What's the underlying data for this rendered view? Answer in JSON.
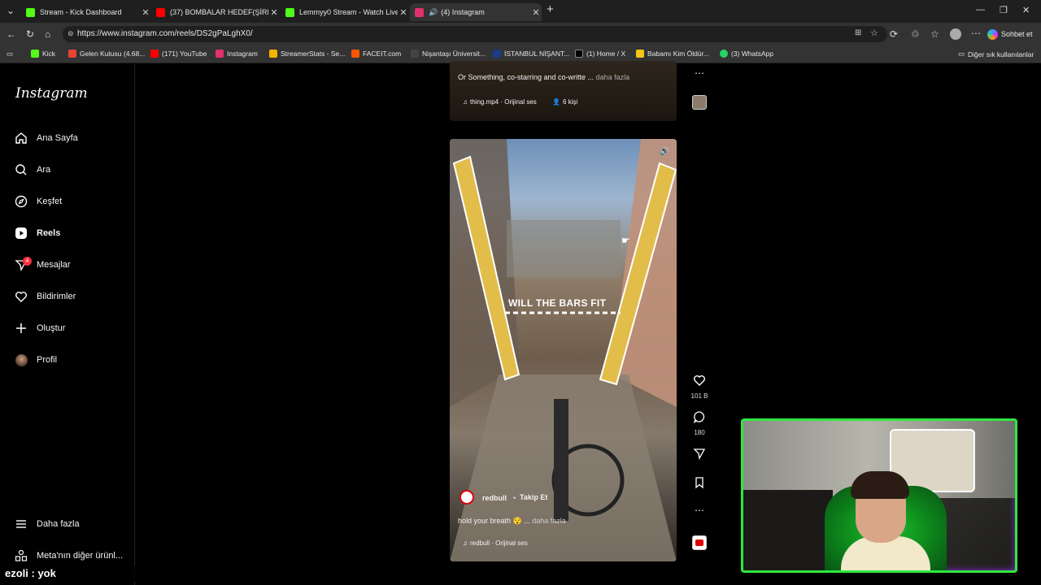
{
  "browser": {
    "tabs": [
      {
        "title": "Stream - Kick Dashboard",
        "color": "#53fc18"
      },
      {
        "title": "(37) BOMBALAR HEDEF(ŞİRKET) B",
        "color": "#ff0000"
      },
      {
        "title": "Lemmyy0 Stream - Watch Live on",
        "color": "#53fc18"
      },
      {
        "title": "(4) Instagram",
        "color": "#e1306c"
      }
    ],
    "url": "https://www.instagram.com/reels/DS2gPaLghX0/",
    "copilot_label": "Sohbet et",
    "bookmarks": [
      {
        "label": "Kick",
        "color": "#53fc18"
      },
      {
        "label": "Gelen Kutusu (4.68...",
        "color": "#ea4335"
      },
      {
        "label": "(171) YouTube",
        "color": "#ff0000"
      },
      {
        "label": "Instagram",
        "color": "#e1306c"
      },
      {
        "label": "StreamerStats - Se...",
        "color": "#f4b400"
      },
      {
        "label": "FACEIT.com",
        "color": "#ff5500"
      },
      {
        "label": "Nişantaşı Üniversit...",
        "color": "#444444"
      },
      {
        "label": "İSTANBUL NİŞANT...",
        "color": "#1a3b8c"
      },
      {
        "label": "(1) Home / X",
        "color": "#000000"
      },
      {
        "label": "Babamı Kim Öldür...",
        "color": "#f5c518"
      },
      {
        "label": "(3) WhatsApp",
        "color": "#25d366"
      }
    ],
    "other_favorites": "Diğer sık kullanılanlar"
  },
  "sidebar": {
    "brand": "Instagram",
    "items": [
      {
        "label": "Ana Sayfa",
        "icon": "home-icon"
      },
      {
        "label": "Ara",
        "icon": "search-icon"
      },
      {
        "label": "Keşfet",
        "icon": "compass-icon"
      },
      {
        "label": "Reels",
        "icon": "reels-icon"
      },
      {
        "label": "Mesajlar",
        "icon": "messenger-icon",
        "badge": "4"
      },
      {
        "label": "Bildirimler",
        "icon": "heart-icon"
      },
      {
        "label": "Oluştur",
        "icon": "plus-icon"
      },
      {
        "label": "Profil",
        "icon": "avatar-icon"
      }
    ],
    "more": "Daha fazla",
    "meta": "Meta'nın diğer ürünl..."
  },
  "reel_top": {
    "caption": "Or Something, co-starring and co-writte ...",
    "more": "daha fazla",
    "audio": "thing.mp4 · Orijinal ses",
    "people": "6 kişi"
  },
  "reel_main": {
    "overlay_text": "WILL THE BARS FIT",
    "account": "redbull",
    "follow": "Takip Et",
    "caption": "hold your breath 😯 ...",
    "more": "daha fazla",
    "audio": "redbull · Orijinal ses"
  },
  "actions": {
    "likes": "101 B",
    "comments": "180"
  },
  "chat": {
    "line": "ezoli : yok"
  }
}
